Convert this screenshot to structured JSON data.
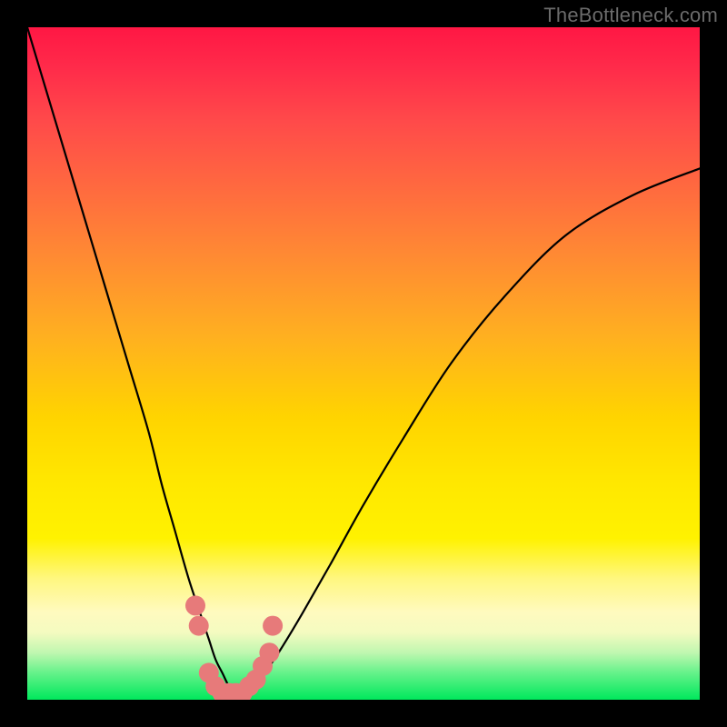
{
  "watermark": "TheBottleneck.com",
  "chart_data": {
    "type": "line",
    "title": "",
    "xlabel": "",
    "ylabel": "",
    "xlim": [
      0,
      100
    ],
    "ylim": [
      0,
      100
    ],
    "series": [
      {
        "name": "bottleneck-curve",
        "x": [
          0,
          3,
          6,
          9,
          12,
          15,
          18,
          20,
          22,
          24,
          26,
          27,
          28,
          29,
          30,
          31,
          32,
          33,
          34,
          36,
          38,
          41,
          45,
          50,
          56,
          63,
          71,
          80,
          90,
          100
        ],
        "values": [
          100,
          90,
          80,
          70,
          60,
          50,
          40,
          32,
          25,
          18,
          12,
          9,
          6,
          4,
          2,
          1,
          1,
          2,
          3,
          5,
          8,
          13,
          20,
          29,
          39,
          50,
          60,
          69,
          75,
          79
        ]
      }
    ],
    "markers": {
      "name": "highlight-dots",
      "color": "#e77a7a",
      "points": [
        {
          "x": 25.0,
          "y": 14
        },
        {
          "x": 25.5,
          "y": 11
        },
        {
          "x": 27.0,
          "y": 4
        },
        {
          "x": 28.0,
          "y": 2
        },
        {
          "x": 29.0,
          "y": 1
        },
        {
          "x": 30.0,
          "y": 1
        },
        {
          "x": 31.0,
          "y": 1
        },
        {
          "x": 32.0,
          "y": 1
        },
        {
          "x": 33.0,
          "y": 2
        },
        {
          "x": 34.0,
          "y": 3
        },
        {
          "x": 35.0,
          "y": 5
        },
        {
          "x": 36.0,
          "y": 7
        },
        {
          "x": 36.5,
          "y": 11
        }
      ]
    },
    "gradient_stops": [
      {
        "pos": 0.0,
        "color": "#ff1744"
      },
      {
        "pos": 0.5,
        "color": "#ffd400"
      },
      {
        "pos": 0.85,
        "color": "#fff780"
      },
      {
        "pos": 1.0,
        "color": "#00e85c"
      }
    ]
  }
}
